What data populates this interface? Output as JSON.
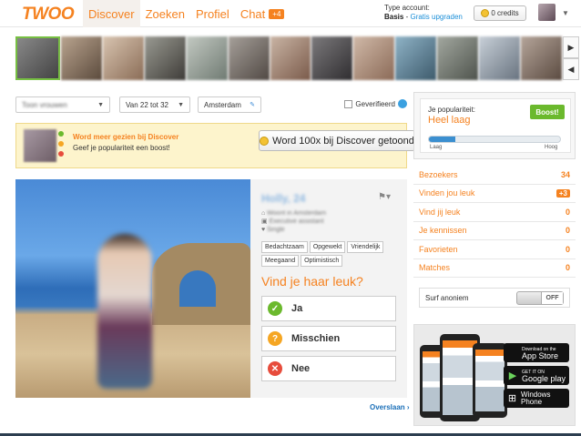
{
  "brand": {
    "logo": "TWOO",
    "accent": "#f58220"
  },
  "nav": {
    "items": [
      {
        "label": "Discover",
        "active": true
      },
      {
        "label": "Zoeken"
      },
      {
        "label": "Profiel"
      },
      {
        "label": "Chat",
        "badge": "+4"
      }
    ]
  },
  "account": {
    "type_label": "Type account:",
    "type_value": "Basis",
    "sep": " - ",
    "upgrade": "Gratis upgraden",
    "credits": "0 credits"
  },
  "strip": {
    "photo_count": 13
  },
  "filters": {
    "gender": "Toon vrouwen",
    "age": "Van 22 tot 32",
    "location": "Amsterdam",
    "verified": "Geverifieerd"
  },
  "promo": {
    "line1": "Word meer gezien bij Discover",
    "line2": "Geef je populariteit een boost!",
    "button": "Word 100x bij Discover getoond"
  },
  "profile": {
    "name": "Holly, 24",
    "info": [
      "Woont in Amsterdam",
      "Executive assistant",
      "Single"
    ],
    "tags": [
      "Bedachtzaam",
      "Opgewekt",
      "Vriendelijk",
      "Meegaand",
      "Optimistisch"
    ],
    "question": "Vind je haar leuk?",
    "answers": {
      "yes": "Ja",
      "maybe": "Misschien",
      "no": "Nee"
    },
    "skip": "Overslaan ›"
  },
  "popularity": {
    "label": "Je populariteit:",
    "value": "Heel laag",
    "boost": "Boost!",
    "level": 0.2,
    "low": "Laag",
    "high": "Hoog"
  },
  "stats": [
    {
      "label": "Bezoekers",
      "value": "34"
    },
    {
      "label": "Vinden jou leuk",
      "value": "+3",
      "badge": true
    },
    {
      "label": "Vind jij leuk",
      "value": "0"
    },
    {
      "label": "Je kennissen",
      "value": "0"
    },
    {
      "label": "Favorieten",
      "value": "0"
    },
    {
      "label": "Matches",
      "value": "0"
    }
  ],
  "surf": {
    "label": "Surf anoniem",
    "toggle": "OFF"
  },
  "stores": {
    "apple": {
      "small": "Download on the",
      "big": "App Store"
    },
    "google": {
      "small": "GET IT ON",
      "big": "Google play"
    },
    "windows": {
      "small": "",
      "big": "Windows Phone"
    }
  }
}
